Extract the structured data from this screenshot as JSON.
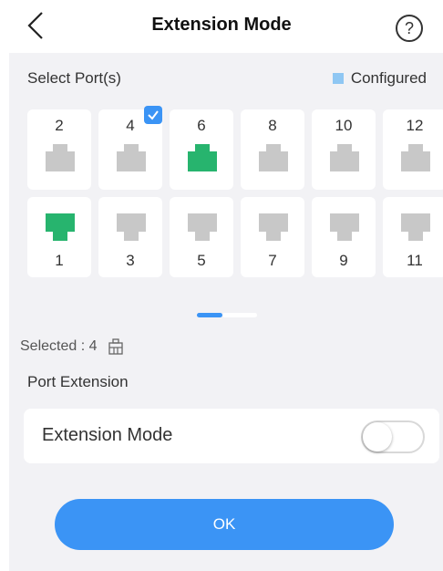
{
  "header": {
    "title": "Extension Mode",
    "back_icon": "chevron-left-icon",
    "help_icon": "question-circle-icon",
    "help_symbol": "?"
  },
  "ports_section": {
    "label": "Select Port(s)",
    "legend_label": "Configured",
    "legend_color": "#8fc7f3",
    "top_row": [
      {
        "number": "2",
        "state": "default",
        "checked": false
      },
      {
        "number": "4",
        "state": "default",
        "checked": true
      },
      {
        "number": "6",
        "state": "active",
        "checked": false
      },
      {
        "number": "8",
        "state": "default",
        "checked": false
      },
      {
        "number": "10",
        "state": "default",
        "checked": false
      },
      {
        "number": "12",
        "state": "default",
        "checked": false
      }
    ],
    "bottom_row": [
      {
        "number": "1",
        "state": "active",
        "checked": false
      },
      {
        "number": "3",
        "state": "default",
        "checked": false
      },
      {
        "number": "5",
        "state": "default",
        "checked": false
      },
      {
        "number": "7",
        "state": "default",
        "checked": false
      },
      {
        "number": "9",
        "state": "default",
        "checked": false
      },
      {
        "number": "11",
        "state": "default",
        "checked": false
      }
    ]
  },
  "selection": {
    "text": "Selected : 4",
    "icon": "building-icon"
  },
  "port_extension": {
    "section_label": "Port Extension",
    "mode_label": "Extension Mode",
    "enabled": false
  },
  "actions": {
    "ok_label": "OK"
  },
  "colors": {
    "accent": "#3b94f5",
    "port_active": "#27b46e",
    "port_default": "#c8c8c8",
    "background": "#f2f2f5"
  }
}
